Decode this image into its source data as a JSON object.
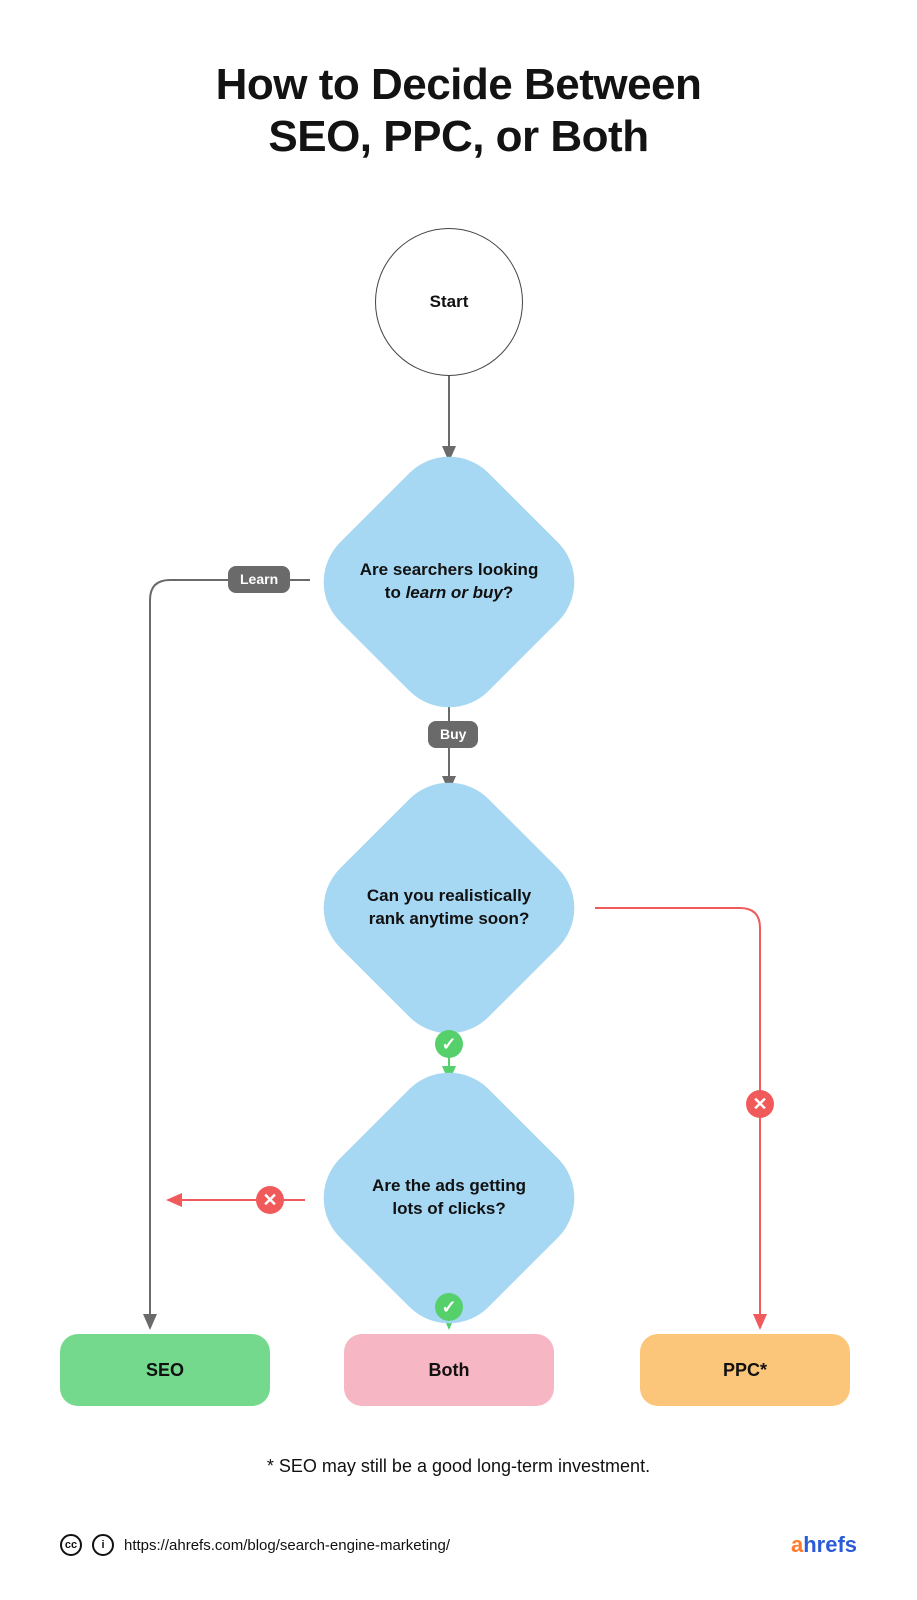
{
  "title": {
    "line1": "How to Decide Between",
    "line2": "SEO, PPC, or Both"
  },
  "nodes": {
    "start": "Start",
    "decision1_prefix": "Are searchers looking to ",
    "decision1_em": "learn or buy",
    "decision1_suffix": "?",
    "decision2": "Can you realistically rank anytime soon?",
    "decision3": "Are the ads getting lots of clicks?"
  },
  "edges": {
    "learn": "Learn",
    "buy": "Buy",
    "yes": "✓",
    "no": "✕"
  },
  "outcomes": {
    "seo": "SEO",
    "both": "Both",
    "ppc": "PPC*"
  },
  "footnote": "* SEO may still be a good long-term investment.",
  "footer": {
    "cc": "cc",
    "by": "i",
    "url": "https://ahrefs.com/blog/search-engine-marketing/",
    "brand_a": "a",
    "brand_rest": "hrefs"
  },
  "colors": {
    "decision": "#a6d7f3",
    "green": "#55d06b",
    "red": "#f15a5a",
    "seo": "#74d98d",
    "both": "#f7b6c3",
    "ppc": "#fcc67a",
    "grey_arrow": "#6a6a6a",
    "green_arrow": "#55d06b",
    "red_arrow": "#f15a5a"
  }
}
